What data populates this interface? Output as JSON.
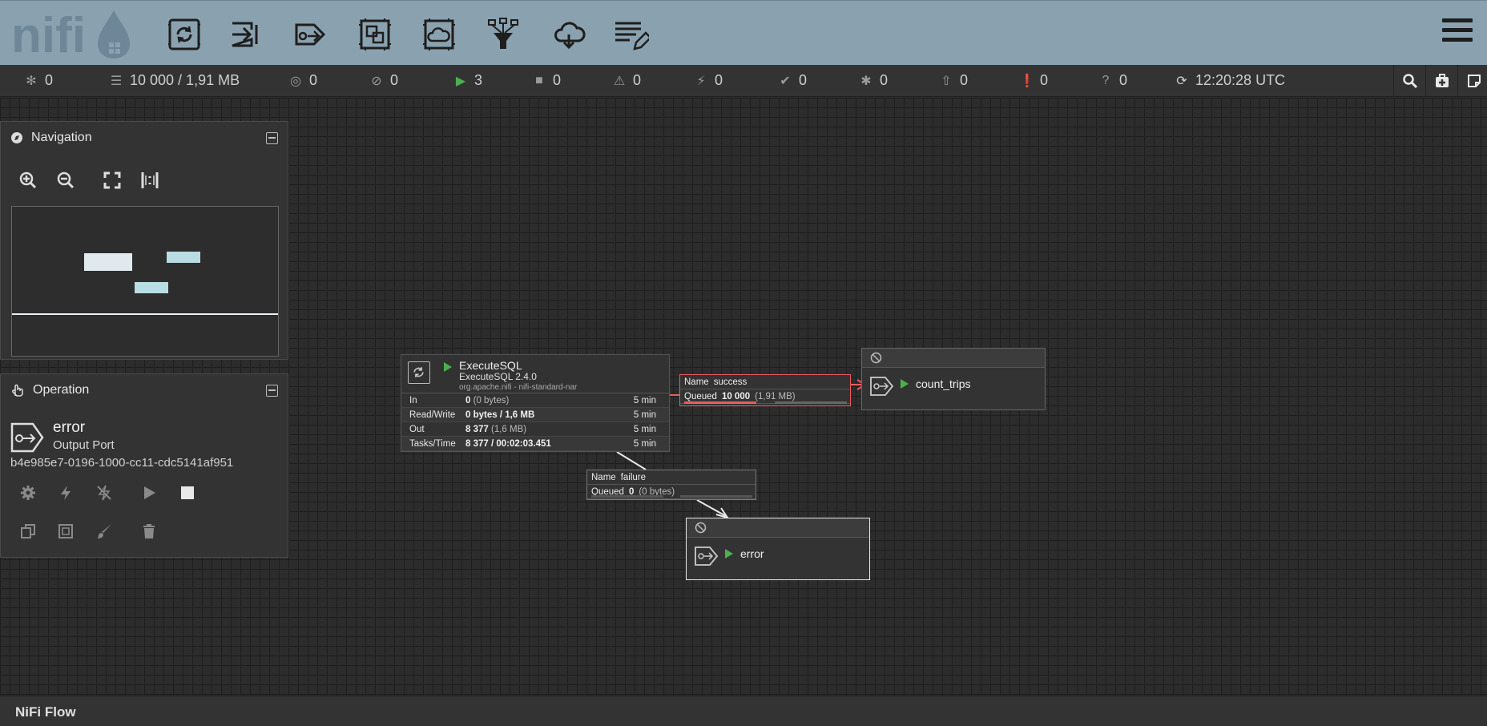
{
  "app": {
    "logo_text": "nifi"
  },
  "toolbar": {
    "items": [
      {
        "name": "processor-tool",
        "label": "Processor"
      },
      {
        "name": "input-port-tool",
        "label": "Input Port"
      },
      {
        "name": "output-port-tool",
        "label": "Output Port"
      },
      {
        "name": "process-group-tool",
        "label": "Process Group"
      },
      {
        "name": "remote-process-group-tool",
        "label": "Remote Process Group"
      },
      {
        "name": "funnel-tool",
        "label": "Funnel"
      },
      {
        "name": "template-tool",
        "label": "Template"
      },
      {
        "name": "label-tool",
        "label": "Label"
      }
    ]
  },
  "status": {
    "transmitting": "0",
    "queued": "10 000 / 1,91 MB",
    "disabled_remote": "0",
    "not_transmitting": "0",
    "running": "3",
    "stopped": "0",
    "invalid": "0",
    "disabled": "0",
    "up_to_date": "0",
    "locally_modified": "0",
    "stale": "0",
    "locally_modified_stale": "0",
    "sync_failure": "0",
    "last_refresh": "12:20:28 UTC"
  },
  "navigation": {
    "title": "Navigation"
  },
  "operation": {
    "title": "Operation",
    "name": "error",
    "type": "Output Port",
    "id": "b4e985e7-0196-1000-cc11-cdc5141af951"
  },
  "processor": {
    "name": "ExecuteSQL",
    "version": "ExecuteSQL 2.4.0",
    "bundle": "org.apache.nifi - nifi-standard-nar",
    "rows": [
      {
        "key": "In",
        "value": "0",
        "detail": "(0 bytes)",
        "time": "5 min"
      },
      {
        "key": "Read/Write",
        "value": "0 bytes / 1,6 MB",
        "detail": "",
        "time": "5 min"
      },
      {
        "key": "Out",
        "value": "8 377",
        "detail": "(1,6 MB)",
        "time": "5 min"
      },
      {
        "key": "Tasks/Time",
        "value": "8 377 / 00:02:03.451",
        "detail": "",
        "time": "5 min"
      }
    ]
  },
  "connections": {
    "success": {
      "name_label": "Name",
      "name": "success",
      "queued_label": "Queued",
      "count": "10 000",
      "size": "(1,91 MB)"
    },
    "failure": {
      "name_label": "Name",
      "name": "failure",
      "queued_label": "Queued",
      "count": "0",
      "size": "(0 bytes)"
    }
  },
  "ports": {
    "count_trips": {
      "name": "count_trips"
    },
    "error": {
      "name": "error"
    }
  },
  "footer": {
    "breadcrumb": "NiFi Flow"
  },
  "colors": {
    "header": "#8aa2b0",
    "running": "#4caf50",
    "selected_connection": "#e85d5d"
  }
}
